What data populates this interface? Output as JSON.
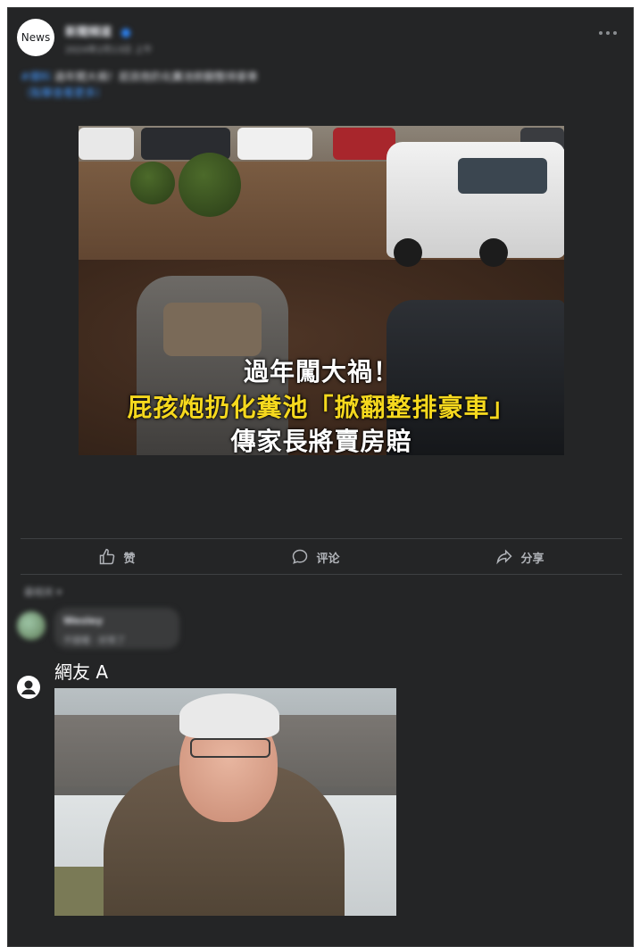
{
  "post": {
    "avatar_text": "News",
    "page_name": "新聞頻道",
    "time": "2024年2月13日 上午",
    "caption_tag": "#爆料",
    "caption_text": "過年闖大禍！屁孩炮扔化糞池掀翻整排豪車",
    "caption_more": "（點擊查看更多）",
    "image_headline_1": "過年闖大禍！",
    "image_headline_2": "屁孩炮扔化糞池「掀翻整排豪車」",
    "image_headline_3": "傳家長將賣房賠"
  },
  "actions": {
    "like_label": "赞",
    "comment_label": "评论",
    "share_label": "分享"
  },
  "comments": {
    "sort_label": "最相关 ▾",
    "first_comment": {
      "name": "Wesley",
      "text": "不錯喔 · 好笑了"
    },
    "second_comment": {
      "name": "網友 A",
      "image": "photo of an elderly man in a brown winter coat and glasses"
    }
  },
  "colors": {
    "background": "#242526",
    "headline_yellow": "#f5d81e",
    "text": "#e4e6eb",
    "muted": "#b0b3b8"
  }
}
